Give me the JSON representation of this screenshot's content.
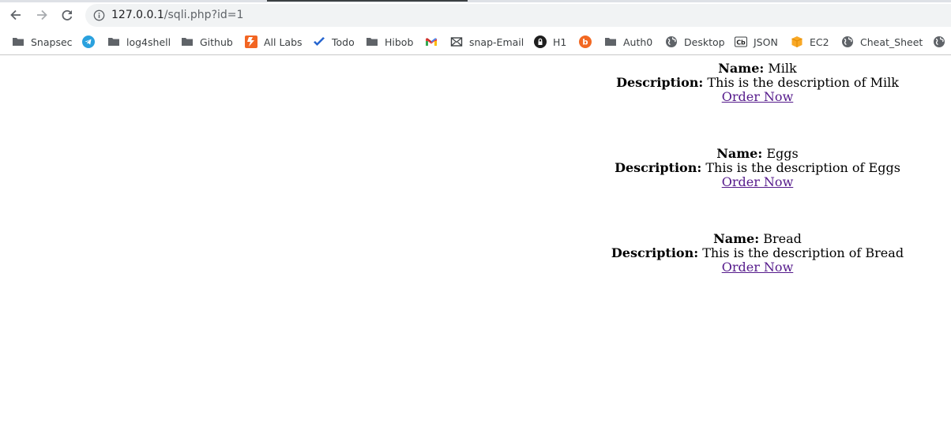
{
  "browser": {
    "url_host": "127.0.0.1",
    "url_path": "/sqli.php?id=1",
    "bookmarks": [
      {
        "label": "Snapsec",
        "icon": "folder-icon"
      },
      {
        "label": "",
        "icon": "telegram-icon"
      },
      {
        "label": "log4shell",
        "icon": "folder-icon"
      },
      {
        "label": "Github",
        "icon": "folder-icon"
      },
      {
        "label": "All Labs",
        "icon": "labs-icon"
      },
      {
        "label": "Todo",
        "icon": "todo-check-icon"
      },
      {
        "label": "Hibob",
        "icon": "folder-icon"
      },
      {
        "label": "",
        "icon": "gmail-icon"
      },
      {
        "label": "snap-Email",
        "icon": "envelope-icon"
      },
      {
        "label": "H1",
        "icon": "hackerone-icon"
      },
      {
        "label": "",
        "icon": "bugcrowd-icon"
      },
      {
        "label": "Auth0",
        "icon": "folder-icon"
      },
      {
        "label": "Desktop",
        "icon": "globe-icon"
      },
      {
        "label": "JSON",
        "icon": "cyberchef-icon"
      },
      {
        "label": "EC2",
        "icon": "aws-box-icon"
      },
      {
        "label": "Cheat_Sheet",
        "icon": "globe-icon"
      },
      {
        "label": "",
        "icon": "globe-icon"
      }
    ]
  },
  "page": {
    "name_label": "Name:",
    "description_label": "Description:",
    "products": [
      {
        "name": "Milk",
        "description": "This is the description of Milk",
        "link": "Order Now"
      },
      {
        "name": "Eggs",
        "description": "This is the description of Eggs",
        "link": "Order Now"
      },
      {
        "name": "Bread",
        "description": "This is the description of Bread",
        "link": "Order Now"
      }
    ]
  }
}
